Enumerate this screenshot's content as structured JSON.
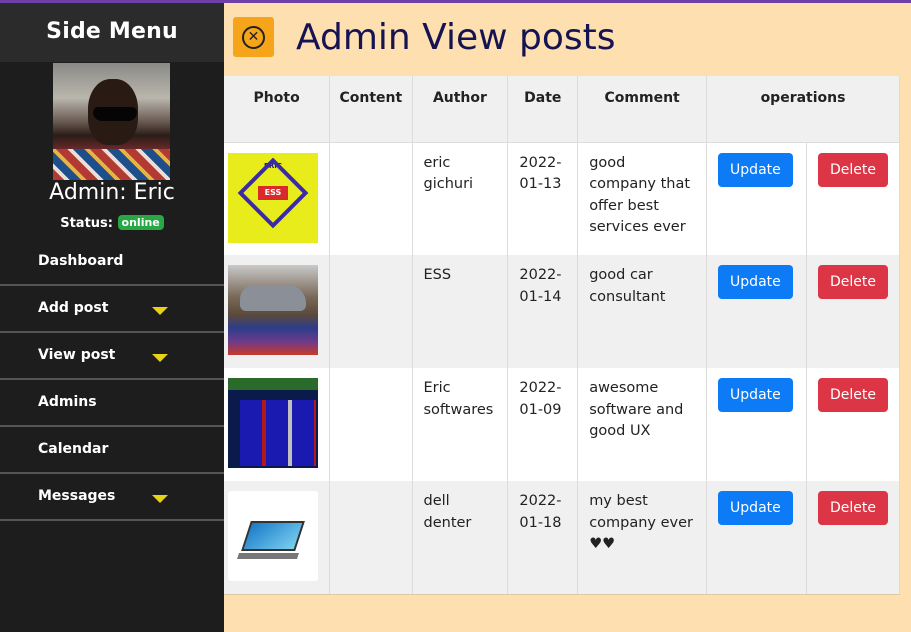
{
  "sidebar": {
    "title": "Side Menu",
    "admin_name": "Admin: Eric",
    "status_label": "Status:",
    "status_badge": "online",
    "items": [
      {
        "label": "Dashboard",
        "has_caret": false
      },
      {
        "label": "Add post",
        "has_caret": true
      },
      {
        "label": "View post",
        "has_caret": true
      },
      {
        "label": "Admins",
        "has_caret": false
      },
      {
        "label": "Calendar",
        "has_caret": false
      },
      {
        "label": "Messages",
        "has_caret": true
      }
    ]
  },
  "header": {
    "title": "Admin View posts",
    "close_icon": "circle-x-icon"
  },
  "table": {
    "columns": [
      "Photo",
      "Content",
      "Author",
      "Date",
      "Comment",
      "operations"
    ],
    "update_label": "Update",
    "delete_label": "Delete",
    "rows": [
      {
        "content": "",
        "author": "eric gichuri",
        "date": "2022-01-13",
        "comment": "good company that offer best services ever"
      },
      {
        "content": "",
        "author": "ESS",
        "date": "2022-01-14",
        "comment": "good car consultant"
      },
      {
        "content": "",
        "author": "Eric softwares",
        "date": "2022-01-09",
        "comment": "awesome software and good UX"
      },
      {
        "content": "",
        "author": "dell denter",
        "date": "2022-01-18",
        "comment": "my best company ever ♥♥"
      }
    ]
  },
  "colors": {
    "sidebar_bg": "#1d1d1d",
    "page_bg": "#fddfb0",
    "title_color": "#161352",
    "update_btn": "#0d7bf5",
    "delete_btn": "#dc3545",
    "online_badge": "#28a745",
    "caret": "#e6d21b"
  }
}
